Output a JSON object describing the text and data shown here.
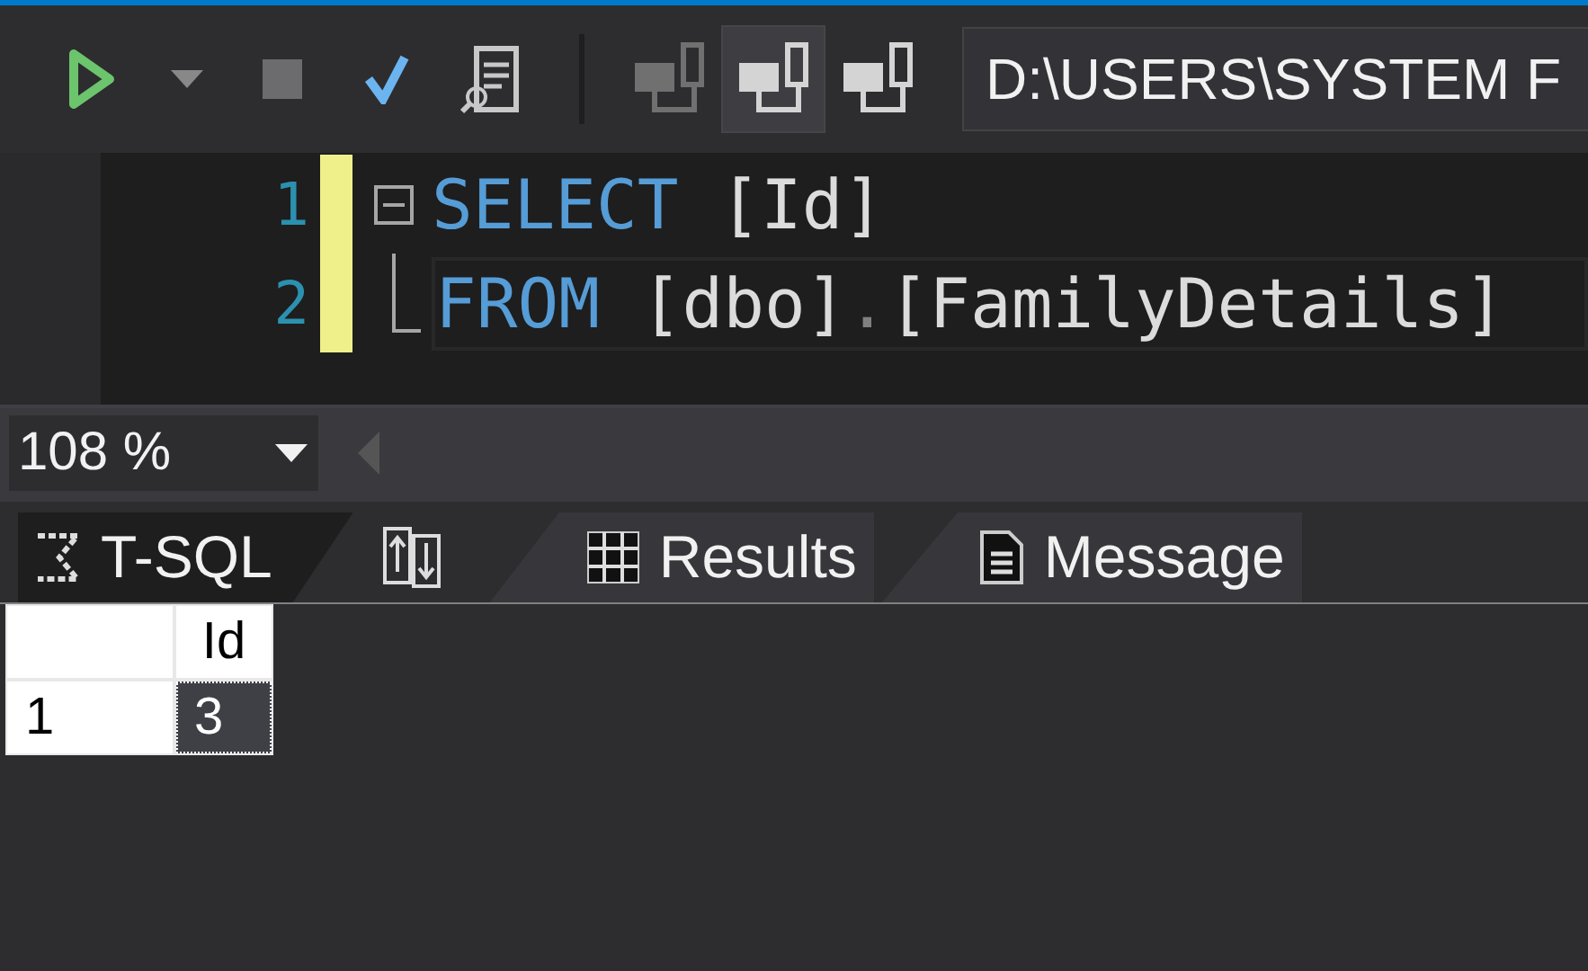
{
  "toolbar": {
    "buttons": [
      {
        "kind": "run",
        "disabled": false,
        "hovered": false
      },
      {
        "kind": "dropdown",
        "disabled": false,
        "hovered": false
      },
      {
        "kind": "stop",
        "disabled": true,
        "hovered": false
      },
      {
        "kind": "parse",
        "disabled": false,
        "hovered": false
      },
      {
        "kind": "plan",
        "disabled": false,
        "hovered": false
      },
      {
        "kind": "separator"
      },
      {
        "kind": "connect",
        "disabled": true,
        "hovered": false
      },
      {
        "kind": "connect",
        "disabled": false,
        "hovered": true
      },
      {
        "kind": "connect",
        "disabled": false,
        "hovered": false
      }
    ],
    "path": "D:\\USERS\\SYSTEM F"
  },
  "editor": {
    "lines": [
      {
        "number": "1",
        "fold": true,
        "current": false,
        "tokens": [
          {
            "kind": "keyword",
            "text": "SELECT"
          },
          {
            "kind": "plain",
            "text": " [Id]"
          }
        ]
      },
      {
        "number": "2",
        "fold": false,
        "current": true,
        "tokens": [
          {
            "kind": "keyword",
            "text": "FROM"
          },
          {
            "kind": "plain",
            "text": " [dbo]"
          },
          {
            "kind": "dot",
            "text": "."
          },
          {
            "kind": "plain",
            "text": "[FamilyDetails]"
          }
        ]
      }
    ]
  },
  "zoom": {
    "value": "108 %"
  },
  "tabs": [
    {
      "label": "T-SQL",
      "selected": true
    },
    {
      "selected": false
    },
    {
      "label": "Results",
      "selected": false
    },
    {
      "label": "Message",
      "selected": false
    }
  ],
  "results": {
    "columns": [
      "Id"
    ],
    "rows": [
      {
        "number": "1",
        "cells": [
          {
            "value": "3",
            "selected": true
          }
        ]
      }
    ]
  }
}
